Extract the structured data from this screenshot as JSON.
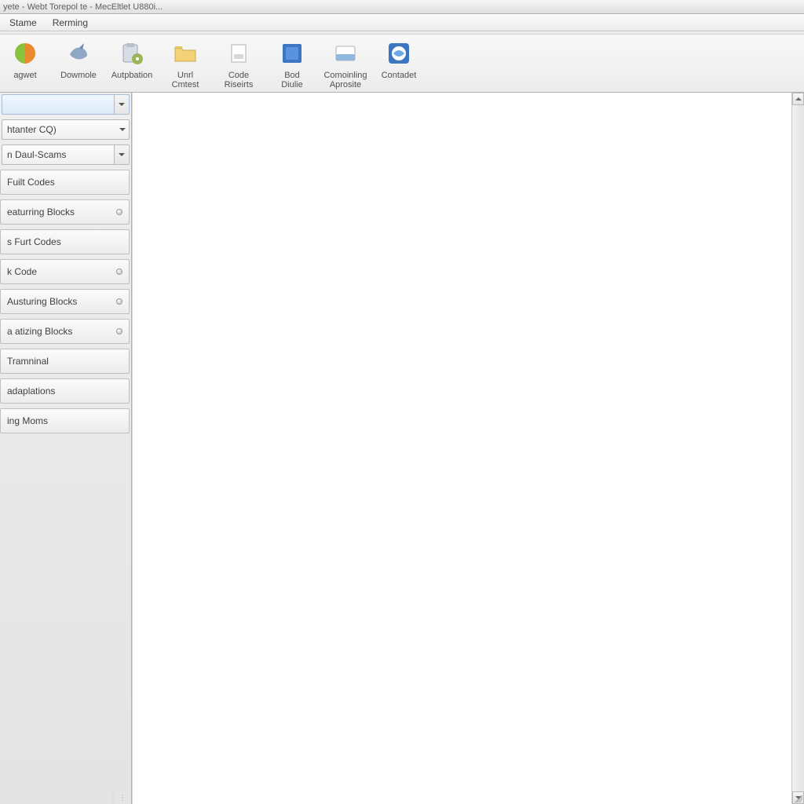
{
  "titlebar": "yete - Webt Torepol te - MecEltlet U880i...",
  "menu": {
    "item0": "Stame",
    "item1": "Rerming"
  },
  "toolbar": {
    "btn0": {
      "label1": "agwet",
      "label2": ""
    },
    "btn1": {
      "label1": "Dowmole",
      "label2": ""
    },
    "btn2": {
      "label1": "Autpbation",
      "label2": ""
    },
    "btn3": {
      "label1": "Unrl",
      "label2": "Cmtest"
    },
    "btn4": {
      "label1": "Code",
      "label2": "Riseirts"
    },
    "btn5": {
      "label1": "Bod",
      "label2": "Diulie"
    },
    "btn6": {
      "label1": "Comoinling",
      "label2": "Aprosite"
    },
    "btn7": {
      "label1": "Contadet",
      "label2": ""
    }
  },
  "sidebar": {
    "combo0": "",
    "combo1": "htanter CQ)",
    "combo2": "n Daul-Scams",
    "items": [
      {
        "label": "Fuilt Codes",
        "dot": false
      },
      {
        "label": "eaturring Blocks",
        "dot": true
      },
      {
        "label": "s Furt Codes",
        "dot": false
      },
      {
        "label": "k Code",
        "dot": true
      },
      {
        "label": "Austuring Blocks",
        "dot": true
      },
      {
        "label": "a atizing Blocks",
        "dot": true
      },
      {
        "label": "Tramninal",
        "dot": false
      },
      {
        "label": "adaplations",
        "dot": false
      },
      {
        "label": "ing Moms",
        "dot": false
      }
    ]
  }
}
